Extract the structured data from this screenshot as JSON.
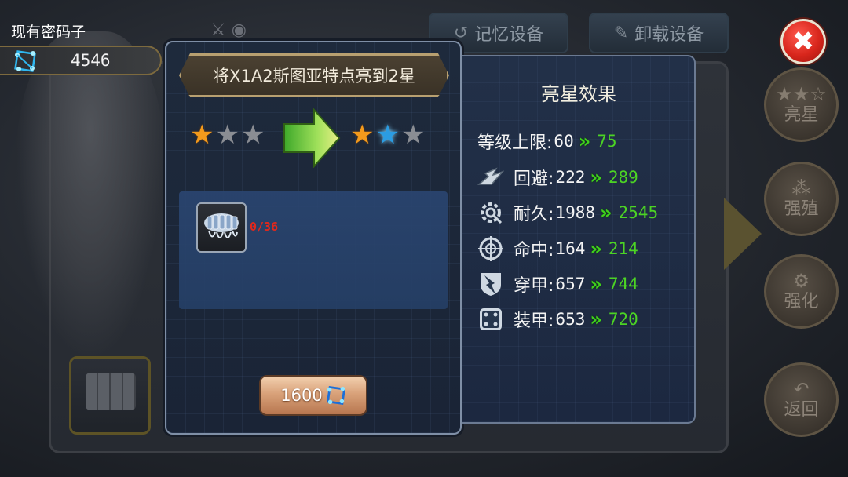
{
  "currency": {
    "label": "现有密码子",
    "amount": "4546",
    "icon": "codon-cube-icon"
  },
  "top_buttons": {
    "memory_label": "记忆设备",
    "unload_label": "卸载设备"
  },
  "side_menu": {
    "star_label": "亮星",
    "breed_label": "强殖",
    "enhance_label": "强化",
    "back_label": "返回"
  },
  "upgrade_dialog": {
    "title": "将X1A2斯图亚特点亮到2星",
    "current_stars": 1,
    "target_stars": 2,
    "max_stars": 3,
    "material": {
      "count": "0/36",
      "icon": "bullet-cartridge-icon"
    },
    "cost": {
      "amount": "1600",
      "icon": "codon-cube-icon"
    }
  },
  "star_effect": {
    "title": "亮星效果",
    "stats": [
      {
        "name": "等级上限:",
        "old": "60",
        "new": "75",
        "icon": ""
      },
      {
        "name": "回避:",
        "old": "222",
        "new": "289",
        "icon": "evade-icon"
      },
      {
        "name": "耐久:",
        "old": "1988",
        "new": "2545",
        "icon": "durability-gear-icon"
      },
      {
        "name": "命中:",
        "old": "164",
        "new": "214",
        "icon": "crosshair-icon"
      },
      {
        "name": "穿甲:",
        "old": "657",
        "new": "744",
        "icon": "pierce-shield-icon"
      },
      {
        "name": "装甲:",
        "old": "653",
        "new": "720",
        "icon": "armor-plate-icon"
      }
    ],
    "arrow_glyph": "»"
  },
  "colors": {
    "star_filled": "#f39a1c",
    "star_new": "#2b9ce2",
    "stat_new_value": "#4cd424",
    "material_insufficient": "#e1281c",
    "close_button": "#d8261c"
  }
}
